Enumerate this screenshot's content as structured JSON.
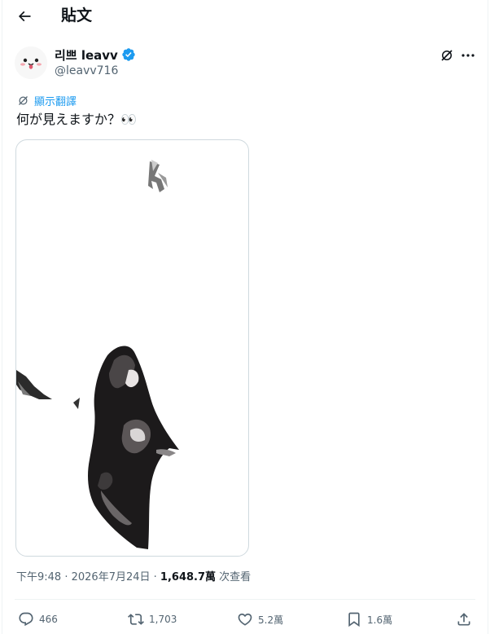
{
  "header": {
    "title": "貼文"
  },
  "author": {
    "display_name": "리쁘 leavv",
    "handle": "@leavv716",
    "verified": true
  },
  "translate": {
    "label": "顯示翻譯"
  },
  "tweet": {
    "text": "何が見えますか？👀"
  },
  "meta": {
    "time": "下午9:48",
    "sep1": " · ",
    "date": "2026年7月24日",
    "sep2": " · ",
    "views": "1,648.7萬",
    "views_label": " 次查看"
  },
  "actions": {
    "replies": "466",
    "reposts": "1,703",
    "likes": "5.2萬",
    "bookmarks": "1.6萬"
  },
  "colors": {
    "accent": "#1d9bf0",
    "text": "#0f1419",
    "muted": "#536471",
    "border": "#cfd9de"
  }
}
